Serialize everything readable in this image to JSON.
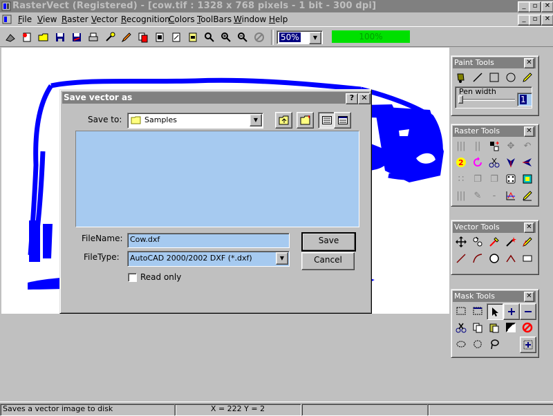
{
  "window": {
    "title": "RasterVect (Registered) - [cow.tif : 1328 x 768 pixels - 1 bit - 300 dpi]",
    "caption_buttons": [
      "_",
      "▫",
      "✕"
    ]
  },
  "menubar": {
    "items": [
      {
        "label": "File",
        "u": "F",
        "rest": "ile"
      },
      {
        "label": "View",
        "u": "V",
        "rest": "iew"
      },
      {
        "label": "Raster",
        "u": "R",
        "rest": "aster"
      },
      {
        "label": "Vector",
        "u": "V",
        "rest": "ector"
      },
      {
        "label": "Recognition",
        "u": "R",
        "rest": "ecognition"
      },
      {
        "label": "Colors",
        "u": "C",
        "rest": "olors"
      },
      {
        "label": "ToolBars",
        "u": "T",
        "rest": "oolBars"
      },
      {
        "label": "Window",
        "u": "W",
        "rest": "indow"
      },
      {
        "label": "Help",
        "u": "H",
        "rest": "elp"
      }
    ]
  },
  "toolbar": {
    "zoom_value": "50%",
    "progress_text": "100%",
    "progress_fraction": 1.0
  },
  "dialog": {
    "title": "Save vector as",
    "save_to_label": "Save to:",
    "save_to_value": "Samples",
    "filename_label": "FileName:",
    "filename_value": "Cow.dxf",
    "filetype_label": "FileType:",
    "filetype_value": "AutoCAD 2000/2002 DXF (*.dxf)",
    "save_button": "Save",
    "cancel_button": "Cancel",
    "readonly_label": "Read only",
    "readonly_checked": false,
    "help_button": "?",
    "close_button": "✕"
  },
  "panels": {
    "paint": {
      "title": "Paint Tools",
      "pen_width_label": "Pen width",
      "pen_width_value": "1"
    },
    "raster": {
      "title": "Raster Tools"
    },
    "vector": {
      "title": "Vector Tools"
    },
    "mask": {
      "title": "Mask Tools"
    }
  },
  "statusbar": {
    "hint": "Saves a vector image to disk",
    "coords": "X = 222  Y = 2"
  },
  "colors": {
    "title_inactive": "#808080",
    "selection_blue": "#a6caf0",
    "image_blue": "#0000ff",
    "progress_green": "#00e000"
  }
}
